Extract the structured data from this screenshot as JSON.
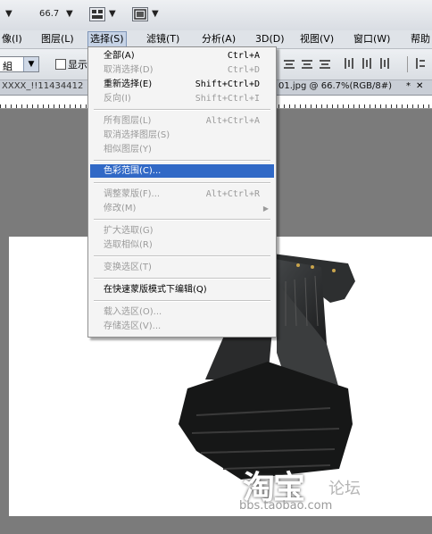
{
  "toolbar": {
    "zoom": "66.7",
    "dropdown_arrow": "▼"
  },
  "menubar": {
    "items": [
      {
        "label": "像(I)"
      },
      {
        "label": "图层(L)"
      },
      {
        "label": "选择(S)",
        "active": true
      },
      {
        "label": "滤镜(T)"
      },
      {
        "label": "分析(A)"
      },
      {
        "label": "3D(D)"
      },
      {
        "label": "视图(V)"
      },
      {
        "label": "窗口(W)"
      },
      {
        "label": "帮助"
      }
    ]
  },
  "options_bar": {
    "group_select": "組",
    "show_checkbox_label": "显示"
  },
  "tabs": {
    "left_tab": "XXXX_!!11434412",
    "right_tab": "01.jpg @ 66.7%(RGB/8#)",
    "close_mark": "*",
    "close_x": "✕"
  },
  "select_menu": {
    "items": [
      {
        "label": "全部(A)",
        "shortcut": "Ctrl+A",
        "enabled": true
      },
      {
        "label": "取消选择(D)",
        "shortcut": "Ctrl+D",
        "enabled": false
      },
      {
        "label": "重新选择(E)",
        "shortcut": "Shift+Ctrl+D",
        "enabled": true
      },
      {
        "label": "反向(I)",
        "shortcut": "Shift+Ctrl+I",
        "enabled": false
      },
      {
        "label": "所有图层(L)",
        "shortcut": "Alt+Ctrl+A",
        "enabled": false
      },
      {
        "label": "取消选择图层(S)",
        "shortcut": "",
        "enabled": false
      },
      {
        "label": "相似图层(Y)",
        "shortcut": "",
        "enabled": false
      },
      {
        "label": "色彩范围(C)...",
        "shortcut": "",
        "enabled": true,
        "highlighted": true
      },
      {
        "label": "调整蒙版(F)...",
        "shortcut": "Alt+Ctrl+R",
        "enabled": false
      },
      {
        "label": "修改(M)",
        "shortcut": "",
        "enabled": false,
        "submenu": true
      },
      {
        "label": "扩大选取(G)",
        "shortcut": "",
        "enabled": false
      },
      {
        "label": "选取相似(R)",
        "shortcut": "",
        "enabled": false
      },
      {
        "label": "变换选区(T)",
        "shortcut": "",
        "enabled": false
      },
      {
        "label": "在快速蒙版模式下编辑(Q)",
        "shortcut": "",
        "enabled": true
      },
      {
        "label": "载入选区(O)...",
        "shortcut": "",
        "enabled": false
      },
      {
        "label": "存储选区(V)...",
        "shortcut": "",
        "enabled": false
      }
    ],
    "submenu_arrow": "▶"
  },
  "watermark": {
    "brand": "淘宝",
    "forum": "论坛",
    "url": "bbs.taobao.com"
  },
  "colors": {
    "menu_highlight": "#3169c6",
    "disabled_text": "#9a9a9a"
  }
}
